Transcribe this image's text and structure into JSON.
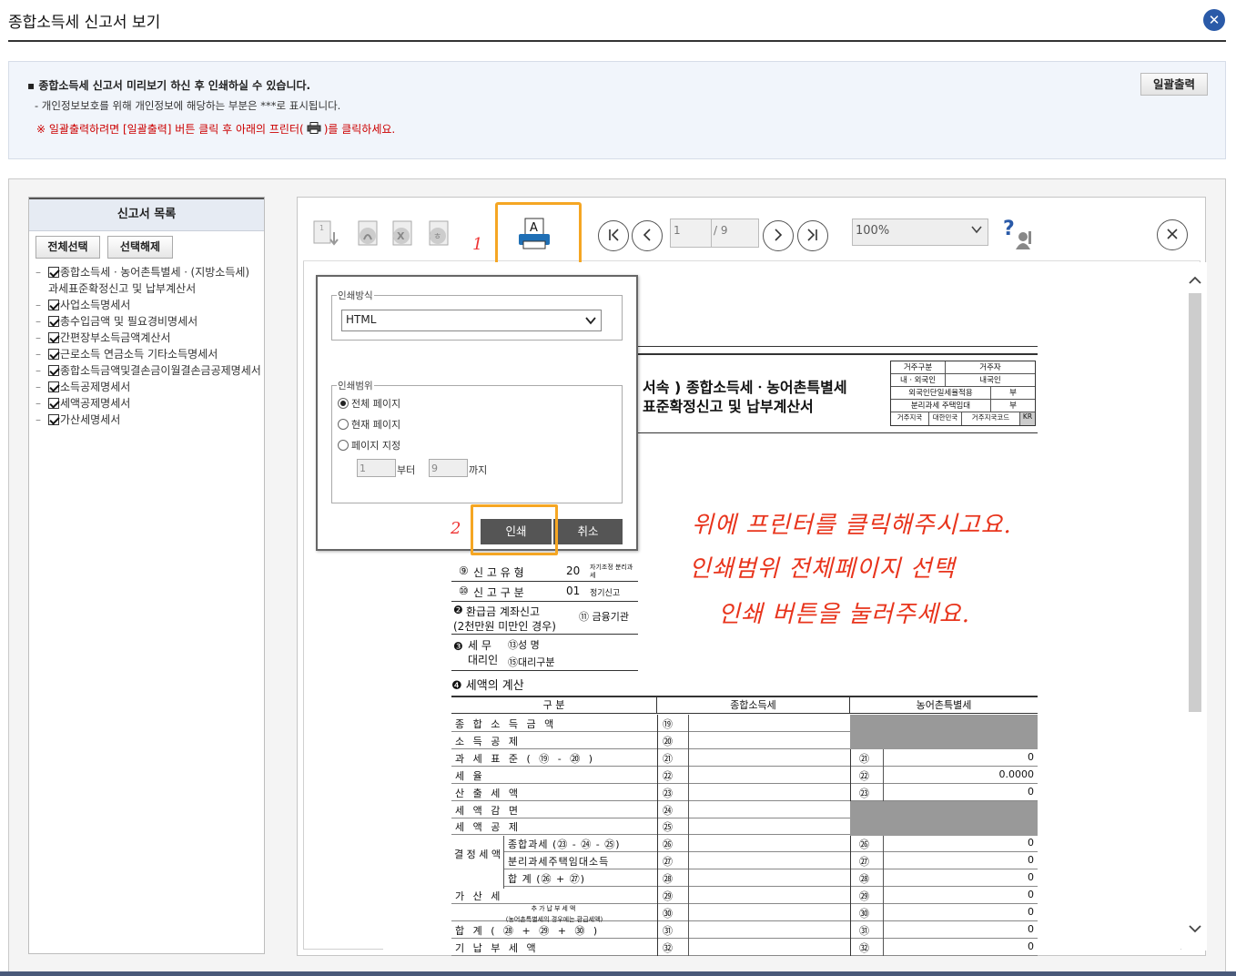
{
  "window": {
    "title": "종합소득세 신고서 보기",
    "close_symbol": "✕"
  },
  "notice": {
    "line1": "종합소득세 신고서 미리보기 하신 후 인쇄하실 수 있습니다.",
    "line2": "- 개인정보보호를 위해 개인정보에 해당하는 부분은 ***로 표시됩니다.",
    "line3_pre": "※ 일괄출력하려면 [일괄출력] 버튼 클릭 후 아래의 프린터(",
    "line3_post": ")를 클릭하세요.",
    "bulk_button": "일괄출력",
    "colors": {
      "warning": "#cc0000",
      "panel_bg": "#f1f5fb"
    }
  },
  "report_list": {
    "header": "신고서 목록",
    "select_all": "전체선택",
    "deselect": "선택해제",
    "items": [
      {
        "label": "종합소득세ㆍ농어촌특별세ㆍ(지방소득세) 과세표준확정신고 및 납부계산서",
        "checked": true
      },
      {
        "label": "사업소득명세서",
        "checked": true
      },
      {
        "label": "총수입금액 및 필요경비명세서",
        "checked": true
      },
      {
        "label": "간편장부소득금액계산서",
        "checked": true
      },
      {
        "label": "근로소득 연금소득 기타소득명세서",
        "checked": true
      },
      {
        "label": "종합소득금액및결손금이월결손금공제명세서",
        "checked": true
      },
      {
        "label": "소득공제명세서",
        "checked": true
      },
      {
        "label": "세액공제명세서",
        "checked": true
      },
      {
        "label": "가산세명세서",
        "checked": true
      }
    ]
  },
  "viewer": {
    "toolbar_icons": [
      "export-icon",
      "pdf-icon",
      "excel-icon",
      "hwp-icon",
      "print-icon"
    ],
    "page_current": "1",
    "page_total": "/ 9",
    "zoom": "100%",
    "help_symbol": "?",
    "accent": "#f5a623"
  },
  "print_dialog": {
    "method_legend": "인쇄방식",
    "method_value": "HTML",
    "range_legend": "인쇄범위",
    "options": [
      "전체 페이지",
      "현재 페이지",
      "페이지 지정"
    ],
    "selected_option": 0,
    "from_value": "1",
    "from_label": "부터",
    "to_value": "9",
    "to_label": "까지",
    "print_button": "인쇄",
    "cancel_button": "취소"
  },
  "annotations": {
    "step1": "1",
    "step2": "2",
    "hand_lines": [
      "위에 프린터를 클릭해주시고요.",
      "인쇄범위 전체페이지 선택",
      "인쇄 버튼을 눌러주세요."
    ]
  },
  "document": {
    "heading1": "서속 ) 종합소득세ㆍ농어촌특별세",
    "heading2": "표준확정신고 및 납부계산서",
    "info_box": [
      [
        "거주구분",
        "거주자"
      ],
      [
        "내ㆍ외국인",
        "내국인"
      ],
      [
        "외국인단일세율적용",
        "부"
      ],
      [
        "분리과세 주택임대",
        "부"
      ],
      [
        "거주지국",
        "대한민국",
        "거주지국코드",
        "KR"
      ]
    ],
    "rows_left": [
      {
        "num": "⑨",
        "label": "신 고 유 형",
        "code": "20",
        "extra": "자기조정 분리과세"
      },
      {
        "num": "⑩",
        "label": "신 고 구 분",
        "code": "01",
        "extra": "정기신고"
      }
    ],
    "refund": {
      "num": "❷",
      "label": "환급금 계좌신고",
      "sub": "(2천만원 미만인 경우)",
      "field": "⑪ 금융기관"
    },
    "agent": {
      "num": "❸",
      "label": "세 무 대리인",
      "name": "⑬성 명",
      "type": "⑮대리구분"
    },
    "section4": "❹ 세액의 계산",
    "col_headers": [
      "구 분",
      "종합소득세",
      "농어촌특별세"
    ],
    "tax_rows": [
      {
        "label": "종 합 소 득 금 액",
        "num": "⑲",
        "value": ""
      },
      {
        "label": "소 득 공 제",
        "num": "⑳",
        "value": ""
      },
      {
        "label": "과 세 표 준 ( ⑲ - ⑳ )",
        "num": "㉑",
        "value": "0"
      },
      {
        "label": "세 율",
        "num": "㉒",
        "value": "0.0000"
      },
      {
        "label": "산 출 세 액",
        "num": "㉓",
        "value": "0"
      },
      {
        "label": "세 액 감 면",
        "num": "㉔",
        "value": ""
      },
      {
        "label": "세 액 공 제",
        "num": "㉕",
        "value": ""
      },
      {
        "label": "종합과세 (㉓ - ㉔ - ㉕)",
        "num": "㉖",
        "value": "0"
      },
      {
        "label": "분리과세주택임대소득",
        "num": "㉗",
        "value": "0"
      },
      {
        "label": "합 계 (㉖ + ㉗)",
        "num": "㉘",
        "value": "0"
      },
      {
        "label": "가 산 세",
        "num": "㉙",
        "value": "0"
      },
      {
        "label": "추가납부세액",
        "num": "㉚",
        "value": "0"
      },
      {
        "label": "합 계 ( ㉘ + ㉙ + ㉚ )",
        "num": "㉛",
        "value": "0"
      },
      {
        "label": "기 납 부 세 액",
        "num": "㉜",
        "value": "0"
      }
    ],
    "decision_label": "결 정 세 액",
    "additional_note": "(농어촌특별세의 경우에는 환급세액)"
  }
}
